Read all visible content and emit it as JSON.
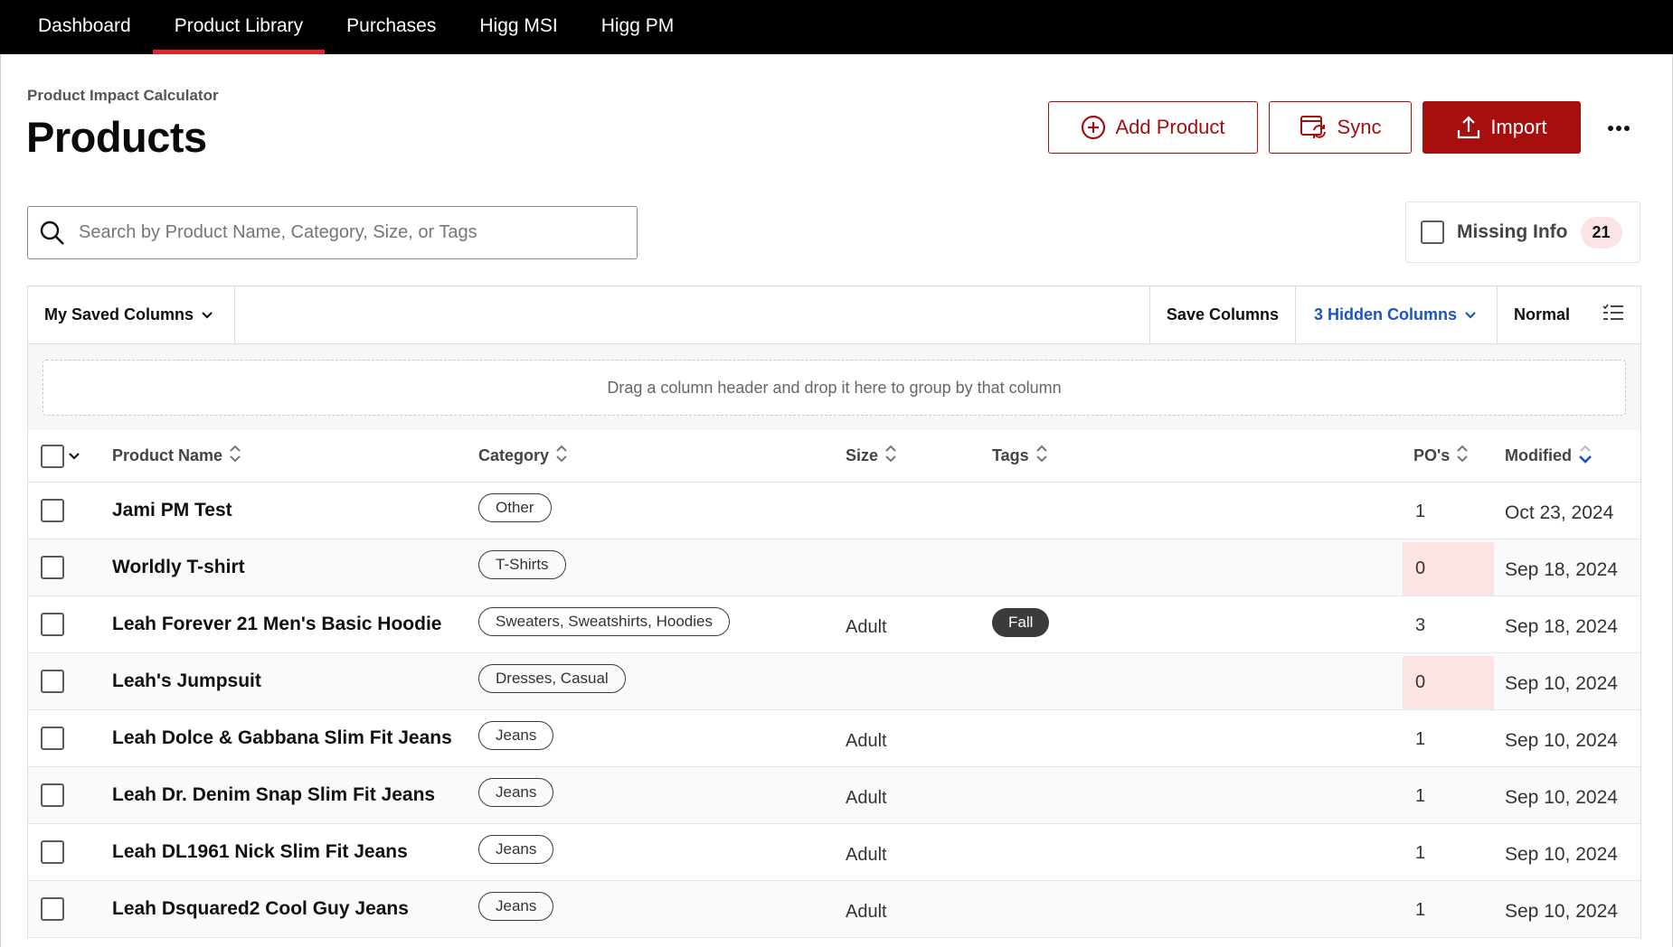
{
  "nav": {
    "items": [
      {
        "label": "Dashboard",
        "active": false
      },
      {
        "label": "Product Library",
        "active": true
      },
      {
        "label": "Purchases",
        "active": false
      },
      {
        "label": "Higg MSI",
        "active": false
      },
      {
        "label": "Higg PM",
        "active": false
      }
    ],
    "active_color": "#e4232f"
  },
  "header": {
    "subtitle": "Product Impact Calculator",
    "title": "Products",
    "add_label": "Add Product",
    "sync_label": "Sync",
    "import_label": "Import",
    "brand_color": "#a70f0f"
  },
  "search": {
    "placeholder": "Search by Product Name, Category, Size, or Tags",
    "value": ""
  },
  "missing_info": {
    "label": "Missing Info",
    "count": "21",
    "checked": false
  },
  "toolbar": {
    "saved_columns": "My Saved Columns",
    "save_columns": "Save Columns",
    "hidden_columns": "3 Hidden Columns",
    "density": "Normal"
  },
  "group_panel": {
    "text": "Drag a column header and drop it here to group by that column"
  },
  "table": {
    "columns": {
      "name": "Product Name",
      "category": "Category",
      "size": "Size",
      "tags": "Tags",
      "pos": "PO's",
      "modified": "Modified"
    },
    "sorted_column": "modified",
    "rows": [
      {
        "name": "Jami PM Test",
        "category": "Other",
        "size": "",
        "tags": "",
        "pos": "1",
        "modified": "Oct 23, 2024",
        "po_warn": false
      },
      {
        "name": "Worldly T-shirt",
        "category": "T-Shirts",
        "size": "",
        "tags": "",
        "pos": "0",
        "modified": "Sep 18, 2024",
        "po_warn": true
      },
      {
        "name": "Leah Forever 21 Men's Basic Hoodie",
        "category": "Sweaters, Sweatshirts, Hoodies",
        "size": "Adult",
        "tags": "Fall",
        "pos": "3",
        "modified": "Sep 18, 2024",
        "po_warn": false
      },
      {
        "name": "Leah's Jumpsuit",
        "category": "Dresses, Casual",
        "size": "",
        "tags": "",
        "pos": "0",
        "modified": "Sep 10, 2024",
        "po_warn": true
      },
      {
        "name": "Leah Dolce & Gabbana Slim Fit Jeans",
        "category": "Jeans",
        "size": "Adult",
        "tags": "",
        "pos": "1",
        "modified": "Sep 10, 2024",
        "po_warn": false
      },
      {
        "name": "Leah Dr. Denim Snap Slim Fit Jeans",
        "category": "Jeans",
        "size": "Adult",
        "tags": "",
        "pos": "1",
        "modified": "Sep 10, 2024",
        "po_warn": false
      },
      {
        "name": "Leah DL1961 Nick Slim Fit Jeans",
        "category": "Jeans",
        "size": "Adult",
        "tags": "",
        "pos": "1",
        "modified": "Sep 10, 2024",
        "po_warn": false
      },
      {
        "name": "Leah Dsquared2 Cool Guy Jeans",
        "category": "Jeans",
        "size": "Adult",
        "tags": "",
        "pos": "1",
        "modified": "Sep 10, 2024",
        "po_warn": false
      }
    ]
  }
}
